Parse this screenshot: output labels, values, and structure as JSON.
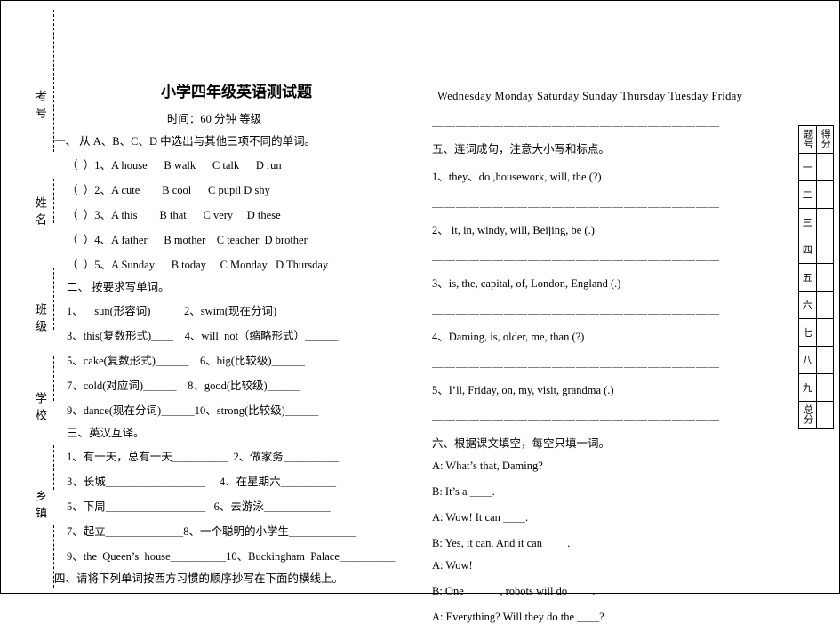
{
  "vertical_labels": [
    "考号",
    "姓名",
    "班级",
    "学校",
    "乡镇"
  ],
  "paper": {
    "title": "小学四年级英语测试题",
    "subtitle": "时间：60 分钟    等级＿＿＿＿"
  },
  "left_column": {
    "section1_heading": "一、 从 A、B、C、D 中选出与其他三项不同的单词。",
    "section1_items": [
      "（  ）1、A house      B walk      C talk      D run",
      "（  ）2、A cute        B cool      C pupil D shy",
      "（  ）3、A this        B that      C very     D these",
      "（  ）4、A father      B mother    C teacher  D brother",
      "（  ）5、A Sunday      B today     C Monday   D Thursday"
    ],
    "section2_heading": "二、 按要求写单词。",
    "section2_items": [
      "1、    sun(形容词)＿＿    2、swim(现在分词)＿＿＿",
      "3、this(复数形式)＿＿    4、will  not（缩略形式）＿＿＿",
      "5、cake(复数形式)＿＿＿    6、big(比较级)＿＿＿",
      "7、cold(对应词)＿＿＿    8、good(比较级)＿＿＿",
      "9、dance(现在分词)＿＿＿10、strong(比较级)＿＿＿"
    ],
    "section3_heading": "三、英汉互译。",
    "section3_items": [
      "1、有一天，总有一天＿＿＿＿＿  2、做家务＿＿＿＿＿",
      "3、长城＿＿＿＿＿＿＿＿＿     4、在星期六＿＿＿＿＿",
      "5、下周＿＿＿＿＿＿＿＿＿   6、去游泳＿＿＿＿＿＿",
      "7、起立＿＿＿＿＿＿＿8、一个聪明的小学生＿＿＿＿＿＿",
      "9、the  Queen’s  house＿＿＿＿＿10、Buckingham  Palace＿＿＿＿＿"
    ],
    "section4_heading": "四、请将下列单词按西方习惯的顺序抄写在下面的横线上。"
  },
  "right_column": {
    "word_list": "Wednesday  Monday  Saturday  Sunday  Thursday  Tuesday  Friday",
    "answer_line": "＿＿＿＿＿＿＿＿＿＿＿＿＿＿＿＿＿＿＿＿＿＿＿＿",
    "section5_heading": "五、连词成句，注意大小写和标点。",
    "section5_items": [
      "1、they、do ,housework, will,  the       (?)",
      "2、    it, in, windy, will, Beijing, be (.)",
      "3、is, the, capital, of, London, England (.)",
      "4、Daming, is, older, me, than (?)",
      "5、I’ll, Friday, on, my, visit, grandma (.)"
    ],
    "section6_heading": "六、根据课文填空，每空只填一词。",
    "dialogue": [
      "A: What’s that, Daming?",
      "B: It’s a  ＿＿.",
      "A: Wow! It can   ＿＿.",
      "B: Yes, it can. And it can  ＿＿.",
      "A: Wow!",
      "B: One ＿＿＿, robots will do  ＿＿.",
      "A: Everything? Will they do the  ＿＿?"
    ]
  },
  "score_table": {
    "header_left": "题号",
    "header_right": "得分",
    "rows": [
      "一",
      "二",
      "三",
      "四",
      "五",
      "六",
      "七",
      "八",
      "九",
      "总分"
    ]
  }
}
